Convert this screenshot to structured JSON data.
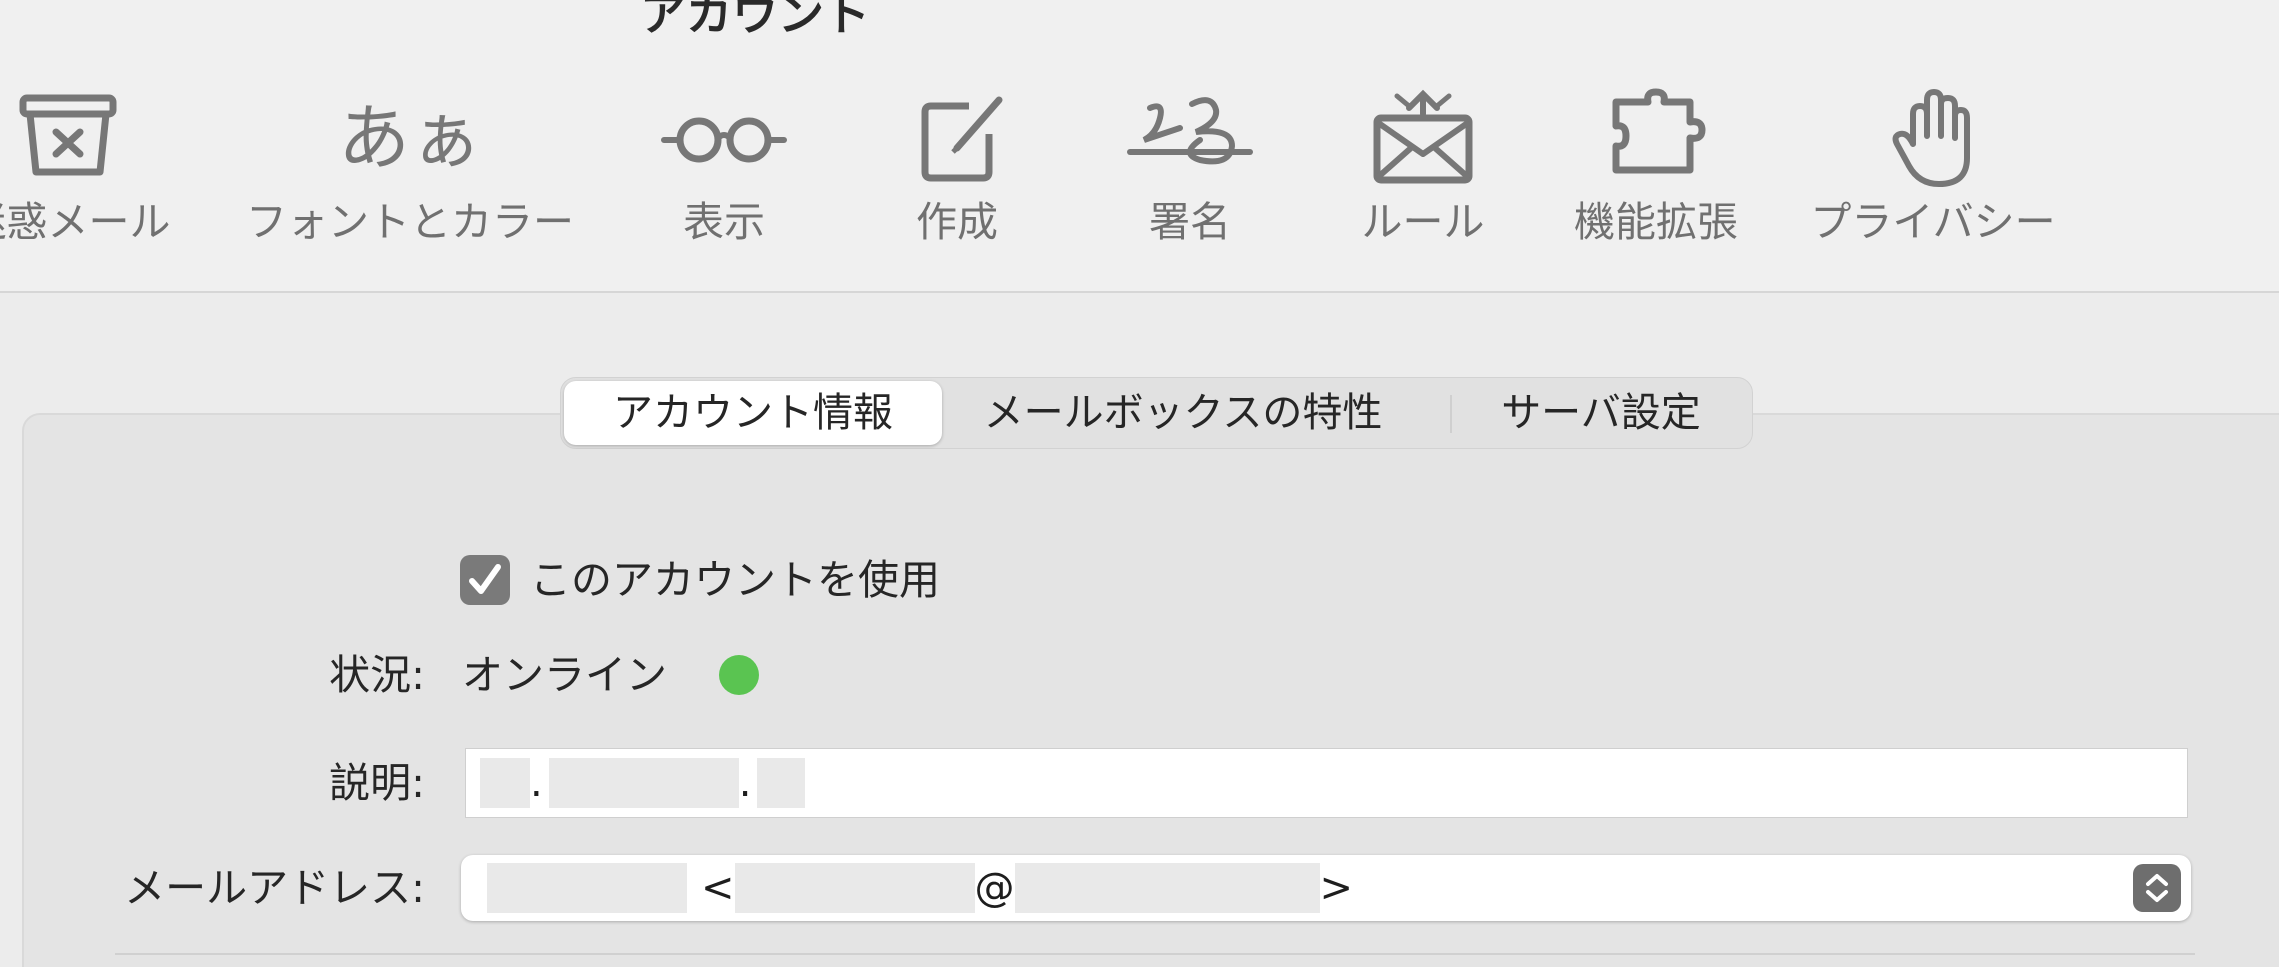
{
  "window": {
    "title": "アカウント"
  },
  "toolbar": {
    "items": [
      {
        "label": "迷惑メール",
        "icon": "junk-mail-icon"
      },
      {
        "label": "フォントとカラー",
        "icon": "fonts-colors-icon",
        "glyph": "あぁ"
      },
      {
        "label": "表示",
        "icon": "glasses-icon"
      },
      {
        "label": "作成",
        "icon": "compose-icon"
      },
      {
        "label": "署名",
        "icon": "signature-icon"
      },
      {
        "label": "ルール",
        "icon": "rules-icon"
      },
      {
        "label": "機能拡張",
        "icon": "puzzle-icon"
      },
      {
        "label": "プライバシー",
        "icon": "hand-icon"
      }
    ]
  },
  "tabs": {
    "items": [
      {
        "label": "アカウント情報",
        "selected": true
      },
      {
        "label": "メールボックスの特性",
        "selected": false
      },
      {
        "label": "サーバ設定",
        "selected": false
      }
    ]
  },
  "account": {
    "enable_label": "このアカウントを使用",
    "enabled": true,
    "status_label": "状況:",
    "status_value": "オンライン",
    "status_color": "#5ac451",
    "description_label": "説明:",
    "description_value_visible": [
      ".",
      "."
    ],
    "email_label": "メールアドレス:",
    "email_value_visible": [
      "<",
      "@",
      ">"
    ]
  },
  "colors": {
    "checkbox": "#7a7a7a",
    "toolbar_bg": "#f0f0f0",
    "panel_bg": "#e4e4e4"
  }
}
